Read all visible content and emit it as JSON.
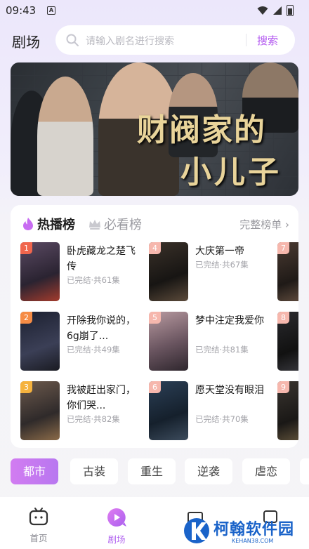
{
  "status_bar": {
    "time": "09:43"
  },
  "header": {
    "title": "剧场"
  },
  "search": {
    "placeholder": "请输入剧名进行搜索",
    "button_label": "搜索"
  },
  "banner": {
    "title_line1": "财阀家的",
    "title_line2": "小儿子"
  },
  "ranking": {
    "tabs": [
      {
        "label": "热播榜"
      },
      {
        "label": "必看榜"
      }
    ],
    "full_list_label": "完整榜单 ›",
    "items": [
      {
        "rank": "1",
        "name": "卧虎藏龙之楚飞传",
        "meta": "已完结·共61集"
      },
      {
        "rank": "2",
        "name": "开除我你说的，6g崩了...",
        "meta": "已完结·共49集"
      },
      {
        "rank": "3",
        "name": "我被赶出家门，你们哭...",
        "meta": "已完结·共82集"
      },
      {
        "rank": "4",
        "name": "大庆第一帝",
        "meta": "已完结·共67集"
      },
      {
        "rank": "5",
        "name": "梦中注定我爱你",
        "meta": "已完结·共81集"
      },
      {
        "rank": "6",
        "name": "愿天堂没有眼泪",
        "meta": "已完结·共70集"
      },
      {
        "rank": "7"
      },
      {
        "rank": "8"
      },
      {
        "rank": "9"
      }
    ]
  },
  "categories": [
    {
      "label": "都市"
    },
    {
      "label": "古装"
    },
    {
      "label": "重生"
    },
    {
      "label": "逆袭"
    },
    {
      "label": "虐恋"
    }
  ],
  "nav": [
    {
      "label": "首页"
    },
    {
      "label": "剧场"
    }
  ],
  "watermark": {
    "text": "柯翰软件园",
    "sub": "KEHAN38.COM"
  },
  "colors": {
    "accent": "#b45cf0",
    "rank_1": "#f0664d",
    "rank_2": "#f68c45",
    "rank_3": "#f5b23e",
    "rank_other": "#f6b7ad"
  }
}
